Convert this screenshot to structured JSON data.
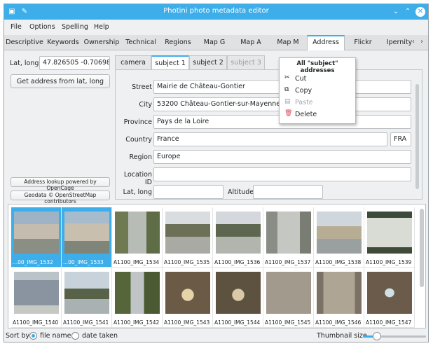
{
  "window": {
    "title": "Photini photo metadata editor"
  },
  "menu": [
    "File",
    "Options",
    "Spelling",
    "Help"
  ],
  "tabs": [
    "Descriptive",
    "Keywords",
    "Ownership",
    "Technical",
    "Regions",
    "Map G",
    "Map A",
    "Map M",
    "Address",
    "Flickr",
    "Ipernity"
  ],
  "active_tab": "Address",
  "left": {
    "latlong_label": "Lat, long",
    "latlong_value": "47.826505 -0.706982",
    "get_address_button": "Get address from lat, long",
    "lookup_credit": "Address lookup powered by OpenCage",
    "geodata_credit": "Geodata © OpenStreetMap contributors"
  },
  "subtabs": [
    "camera",
    "subject 1",
    "subject 2",
    "subject 3"
  ],
  "address": {
    "street_label": "Street",
    "street": "Mairie de Château-Gontier",
    "city_label": "City",
    "city": "53200 Château-Gontier-sur-Mayenne",
    "province_label": "Province",
    "province": "Pays de la Loire",
    "country_label": "Country",
    "country": "France",
    "country_code": "FRA",
    "region_label": "Region",
    "region": "Europe",
    "location_id_label": "Location ID",
    "location_id": "",
    "latlong_label": "Lat, long",
    "latlong": "",
    "altitude_label": "Altitude",
    "altitude": ""
  },
  "context_menu": {
    "title": "All \"subject\" addresses",
    "items": [
      "Cut",
      "Copy",
      "Paste",
      "Delete"
    ]
  },
  "thumbnails": [
    "...00_IMG_1532",
    "...00_IMG_1533",
    "A1100_IMG_1534",
    "A1100_IMG_1535",
    "A1100_IMG_1536",
    "A1100_IMG_1537",
    "A1100_IMG_1538",
    "A1100_IMG_1539",
    "A1100_IMG_1540",
    "A1100_IMG_1541",
    "A1100_IMG_1542",
    "A1100_IMG_1543",
    "A1100_IMG_1544",
    "A1100_IMG_1545",
    "A1100_IMG_1546",
    "A1100_IMG_1547"
  ],
  "status": {
    "sort_by": "Sort by",
    "file_name": "file name",
    "date_taken": "date taken",
    "thumbnail_size": "Thumbnail size"
  },
  "colors": {
    "accent": "#3daee9"
  }
}
